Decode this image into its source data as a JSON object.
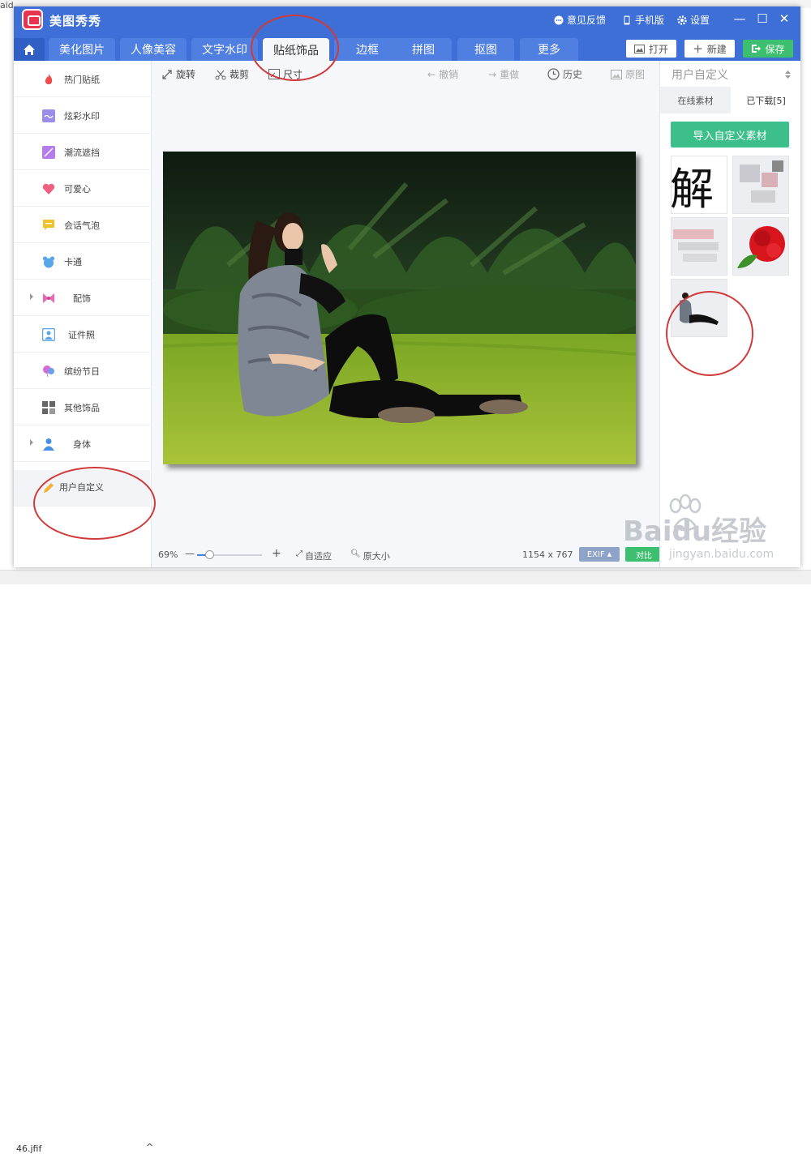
{
  "background": {
    "top_text": "aid",
    "bottom_file": "46.jfif",
    "bottom_chevron": "^"
  },
  "app": {
    "title": "美图秀秀",
    "feedback": "意见反馈",
    "mobile": "手机版",
    "settings": "设置",
    "minimize": "—",
    "maximize": "☐",
    "close": "✕"
  },
  "tabs": [
    {
      "label": "美化图片"
    },
    {
      "label": "人像美容"
    },
    {
      "label": "文字水印"
    },
    {
      "label": "贴纸饰品"
    },
    {
      "label": "边框"
    },
    {
      "label": "拼图"
    },
    {
      "label": "抠图"
    },
    {
      "label": "更多"
    }
  ],
  "top_buttons": {
    "open": "打开",
    "new": "新建",
    "save": "保存"
  },
  "sidebar": {
    "items": [
      {
        "label": "热门贴纸",
        "icon": "flame-icon",
        "color": "#ef4b4b"
      },
      {
        "label": "炫彩水印",
        "icon": "watermark-icon",
        "color": "#9b8ee8"
      },
      {
        "label": "潮流遮挡",
        "icon": "mask-icon",
        "color": "#b37ce8"
      },
      {
        "label": "可爱心",
        "icon": "heart-icon",
        "color": "#f06080"
      },
      {
        "label": "会话气泡",
        "icon": "speech-bubble-icon",
        "color": "#f2c12e"
      },
      {
        "label": "卡通",
        "icon": "bear-icon",
        "color": "#58a6e8"
      },
      {
        "label": "配饰",
        "icon": "bow-icon",
        "color": "#e86ab4"
      },
      {
        "label": "证件照",
        "icon": "id-photo-icon",
        "color": "#58a6e8"
      },
      {
        "label": "缤纷节日",
        "icon": "balloon-icon",
        "color": "#d66ad6"
      },
      {
        "label": "其他饰品",
        "icon": "grid-icon",
        "color": "#666666"
      },
      {
        "label": "身体",
        "icon": "person-icon",
        "color": "#4a90e2"
      },
      {
        "label": "用户自定义",
        "icon": "pencil-icon",
        "color": "#f2b233"
      }
    ]
  },
  "toolbar": {
    "rotate": "旋转",
    "crop": "裁剪",
    "size": "尺寸",
    "undo": "撤销",
    "redo": "重做",
    "history": "历史",
    "original": "原图"
  },
  "statusbar": {
    "zoom": "69%",
    "zoom_minus": "—",
    "zoom_plus": "+",
    "zoom_level": 0.2,
    "fit": "自适应",
    "actual_size": "原大小",
    "dimensions": "1154 x 767",
    "exif": "EXIF",
    "compare": "对比"
  },
  "right_panel": {
    "header": "用户自定义",
    "tabs": [
      {
        "label": "在线素材"
      },
      {
        "label": "已下载[5]"
      }
    ],
    "import_button": "导入自定义素材",
    "thumb_char": "解"
  },
  "watermark": {
    "brand": "Baidu经验",
    "site": "jingyan.baidu.com"
  },
  "colors": {
    "titlebar": "#3d6fd6",
    "accent_green": "#3cbf6f",
    "annotation_red": "#d03a3a"
  }
}
